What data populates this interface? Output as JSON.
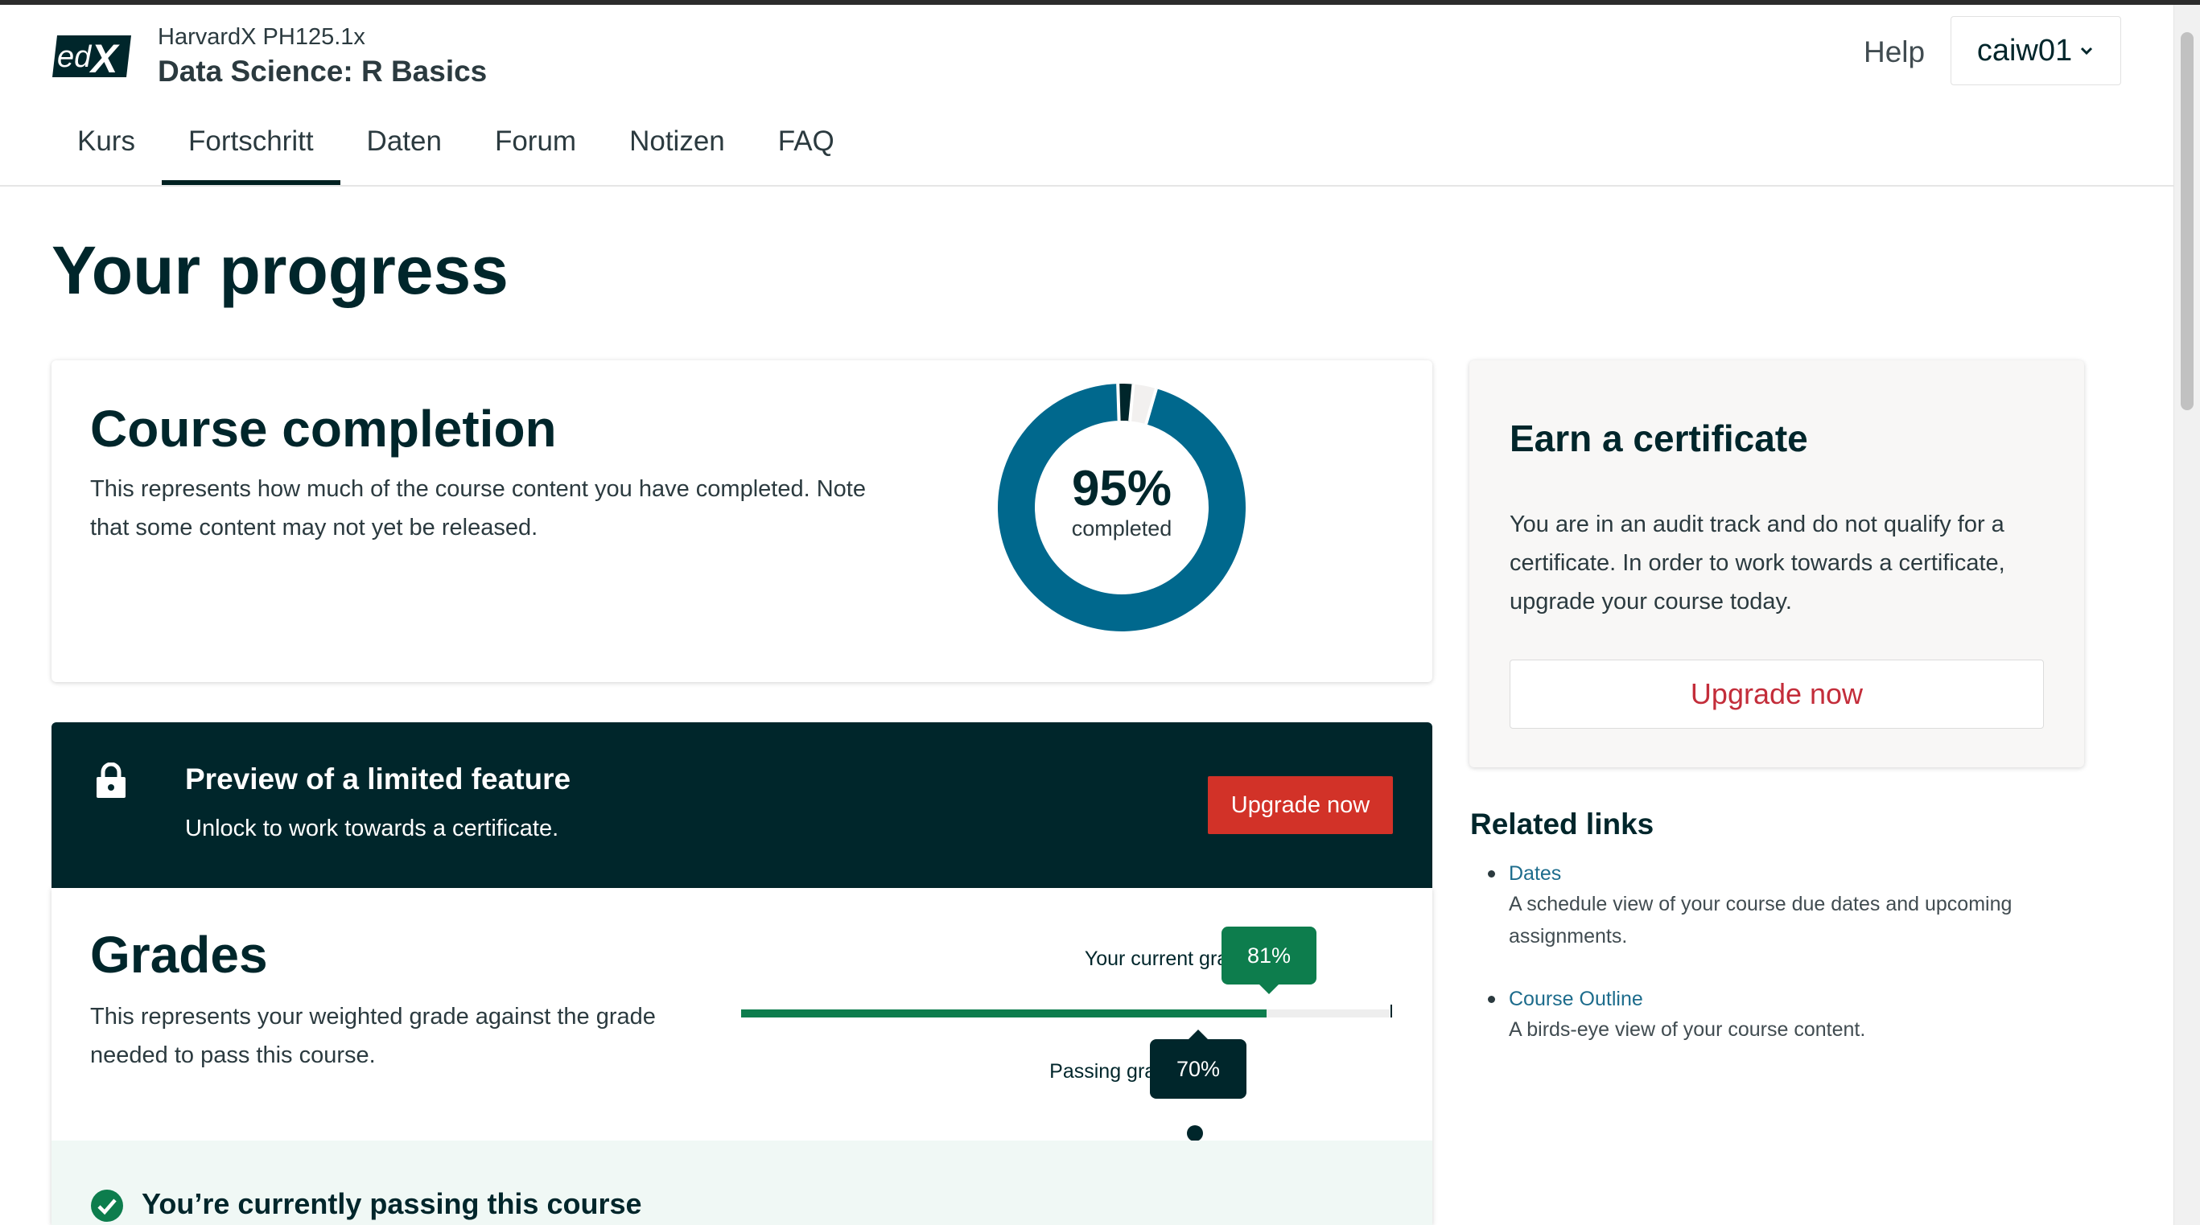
{
  "header": {
    "logo_text": "edX",
    "course_org": "HarvardX PH125.1x",
    "course_title": "Data Science: R Basics",
    "help_label": "Help",
    "username": "caiw01"
  },
  "tabs": [
    {
      "label": "Kurs",
      "active": false
    },
    {
      "label": "Fortschritt",
      "active": true
    },
    {
      "label": "Daten",
      "active": false
    },
    {
      "label": "Forum",
      "active": false
    },
    {
      "label": "Notizen",
      "active": false
    },
    {
      "label": "FAQ",
      "active": false
    }
  ],
  "page_title": "Your progress",
  "completion": {
    "title": "Course completion",
    "description": "This represents how much of the course content you have completed. Note that some content may not yet be released.",
    "percent_text": "95%",
    "completed_label": "completed",
    "complete_fraction": 0.95,
    "incomplete_fraction": 0.02,
    "locked_fraction": 0.03,
    "colors": {
      "complete": "#00688d",
      "incomplete": "#00262b",
      "locked": "#f2f0ef"
    }
  },
  "certificate": {
    "title": "Earn a certificate",
    "description": "You are in an audit track and do not qualify for a certificate. In order to work towards a certificate, upgrade your course today.",
    "button_label": "Upgrade now"
  },
  "preview": {
    "title": "Preview of a limited feature",
    "description": "Unlock to work towards a certificate.",
    "button_label": "Upgrade now",
    "icon": "lock-icon"
  },
  "grades": {
    "title": "Grades",
    "description": "This represents your weighted grade against the grade needed to pass this course.",
    "current_label": "Your current grade",
    "current_value": "81%",
    "current_fraction": 0.81,
    "passing_label": "Passing grade",
    "passing_value": "70%",
    "passing_fraction": 0.7,
    "passing_message": "You’re currently passing this course",
    "colors": {
      "fill": "#0d7d4d",
      "track": "#eeeeee"
    }
  },
  "related": {
    "title": "Related links",
    "items": [
      {
        "label": "Dates",
        "description": "A schedule view of your course due dates and upcoming assignments."
      },
      {
        "label": "Course Outline",
        "description": "A birds-eye view of your course content."
      }
    ]
  }
}
